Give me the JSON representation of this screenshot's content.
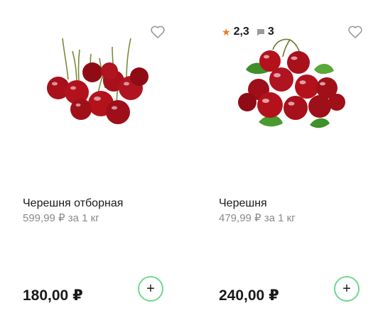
{
  "products": [
    {
      "name": "Черешня отборная",
      "unit_price": "599,99 ₽ за 1 кг",
      "price": "180,00 ₽",
      "add_label": "+",
      "favorite_icon": "heart-outline-icon"
    },
    {
      "name": "Черешня",
      "unit_price": "479,99 ₽ за 1 кг",
      "price": "240,00 ₽",
      "add_label": "+",
      "favorite_icon": "heart-outline-icon",
      "rating": "2,3",
      "reviews": "3"
    }
  ],
  "colors": {
    "accent_green": "#6fd98f",
    "star": "#e67c1f",
    "muted_text": "#8a8a8a",
    "cherry": "#b3121c"
  }
}
